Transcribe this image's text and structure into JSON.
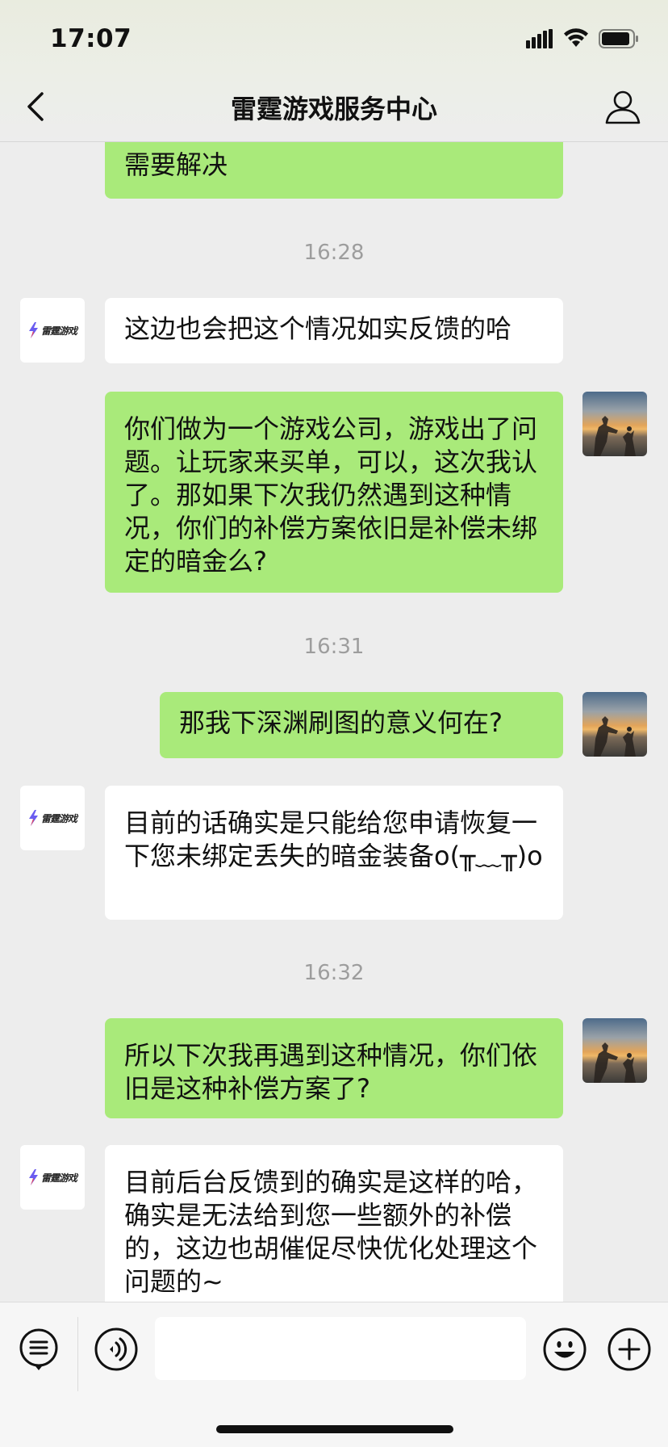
{
  "status_bar": {
    "time": "17:07"
  },
  "nav": {
    "title": "雷霆游戏服务中心"
  },
  "bot": {
    "logo_text": "雷霆游戏"
  },
  "messages": {
    "m0": "需要解决",
    "t1": "16:28",
    "m1": "这边也会把这个情况如实反馈的哈",
    "m2": "你们做为一个游戏公司，游戏出了问题。让玩家来买单，可以，这次我认了。那如果下次我仍然遇到这种情况，你们的补偿方案依旧是补偿未绑定的暗金么?",
    "t2": "16:31",
    "m3": "那我下深渊刷图的意义何在?",
    "m4": "目前的话确实是只能给您申请恢复一下您未绑定丢失的暗金装备o(╥﹏╥)o",
    "t3": "16:32",
    "m5": "所以下次我再遇到这种情况，你们依旧是这种补偿方案了?",
    "m6": "目前后台反馈到的确实是这样的哈，确实是无法给到您一些额外的补偿的，这边也胡催促尽快优化处理这个问题的~"
  },
  "input": {
    "placeholder": ""
  },
  "icons": {
    "back": "chevron-left-icon",
    "profile": "person-icon",
    "menu": "list-icon",
    "voice": "voice-icon",
    "emoji": "emoji-icon",
    "add": "plus-icon"
  },
  "colors": {
    "bubble_self": "#a9ea7a",
    "bubble_other": "#ffffff",
    "background": "#ededed"
  }
}
